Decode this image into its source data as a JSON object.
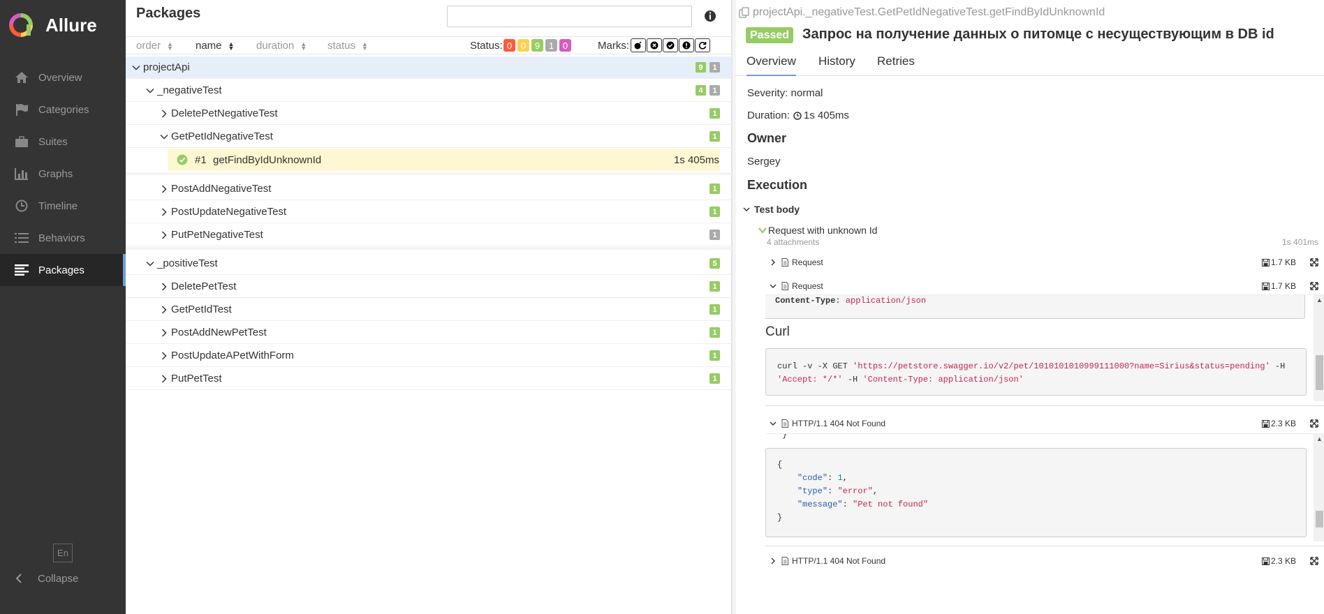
{
  "app": {
    "name": "Allure"
  },
  "sidebar": {
    "items": [
      {
        "label": "Overview",
        "icon": "home-icon"
      },
      {
        "label": "Categories",
        "icon": "flag-icon"
      },
      {
        "label": "Suites",
        "icon": "briefcase-icon"
      },
      {
        "label": "Graphs",
        "icon": "bar-chart-icon"
      },
      {
        "label": "Timeline",
        "icon": "clock-icon"
      },
      {
        "label": "Behaviors",
        "icon": "list-icon"
      },
      {
        "label": "Packages",
        "icon": "align-left-icon",
        "active": true
      }
    ],
    "language": "En",
    "collapse_label": "Collapse"
  },
  "tree": {
    "title": "Packages",
    "search": {
      "value": "",
      "placeholder": ""
    },
    "sort": {
      "order": "order",
      "name": "name",
      "duration": "duration",
      "status": "status"
    },
    "status_label": "Status:",
    "status_counts": [
      {
        "value": "0",
        "color": "#fd5a3e"
      },
      {
        "value": "0",
        "color": "#ffd050"
      },
      {
        "value": "9",
        "color": "#97cc64"
      },
      {
        "value": "1",
        "color": "#aaaaaa"
      },
      {
        "value": "0",
        "color": "#d35ebe"
      }
    ],
    "marks_label": "Marks:",
    "rows": [
      {
        "label": "projectApi",
        "counts": [
          "9",
          "1"
        ]
      },
      {
        "label": "_negativeTest",
        "counts": [
          "4",
          "1"
        ]
      },
      {
        "label": "DeletePetNegativeTest",
        "counts": [
          "1"
        ]
      },
      {
        "label": "GetPetIdNegativeTest",
        "counts": [
          "1"
        ]
      },
      {
        "label": "#1",
        "name": "getFindByIdUnknownId",
        "duration": "1s 405ms"
      },
      {
        "label": "PostAddNegativeTest",
        "counts": [
          "1"
        ]
      },
      {
        "label": "PostUpdateNegativeTest",
        "counts": [
          "1"
        ]
      },
      {
        "label": "PutPetNegativeTest",
        "counts": [
          "1"
        ]
      },
      {
        "label": "_positiveTest",
        "counts": [
          "5"
        ]
      },
      {
        "label": "DeletePetTest",
        "counts": [
          "1"
        ]
      },
      {
        "label": "GetPetIdTest",
        "counts": [
          "1"
        ]
      },
      {
        "label": "PostAddNewPetTest",
        "counts": [
          "1"
        ]
      },
      {
        "label": "PostUpdateAPetWithForm",
        "counts": [
          "1"
        ]
      },
      {
        "label": "PutPetTest",
        "counts": [
          "1"
        ]
      }
    ]
  },
  "detail": {
    "path": "projectApi._negativeTest.GetPetIdNegativeTest.getFindByIdUnknownId",
    "status": "Passed",
    "title": "Запрос на получение данных о питомце с несуществующим в DB id",
    "tabs": [
      "Overview",
      "History",
      "Retries"
    ],
    "severity": "Severity: normal",
    "duration_label": "Duration:",
    "duration_value": "1s 405ms",
    "owner_title": "Owner",
    "owner": "Sergey",
    "execution_title": "Execution",
    "test_body": "Test body",
    "step": {
      "name": "Request with unknown Id",
      "attachments_count": "4 attachments",
      "duration": "1s 401ms"
    },
    "attachments": [
      {
        "name": "Request",
        "size": "1.7 KB"
      },
      {
        "name": "Request",
        "size": "1.7 KB"
      },
      {
        "name": "HTTP/1.1 404 Not Found",
        "size": "2.3 KB"
      },
      {
        "name": "HTTP/1.1 404 Not Found",
        "size": "2.3 KB"
      }
    ],
    "request_frame": {
      "header_key": "Content-Type",
      "header_value": "application/json",
      "curl_title": "Curl",
      "curl_cmd": "curl -v -X GET ",
      "curl_url": "'https://petstore.swagger.io/v2/pet/1010101010999111000?name=Sirius&status=pending'",
      "curl_h": " -H",
      "curl_accept": "'Accept: */*'",
      "curl_h2": " -H ",
      "curl_ct": "'Content-Type: application/json'"
    },
    "response_frame": {
      "code_key": "\"code\"",
      "code_val": "1",
      "type_key": "\"type\"",
      "type_val": "\"error\"",
      "message_key": "\"message\"",
      "message_val": "\"Pet not found\""
    }
  }
}
